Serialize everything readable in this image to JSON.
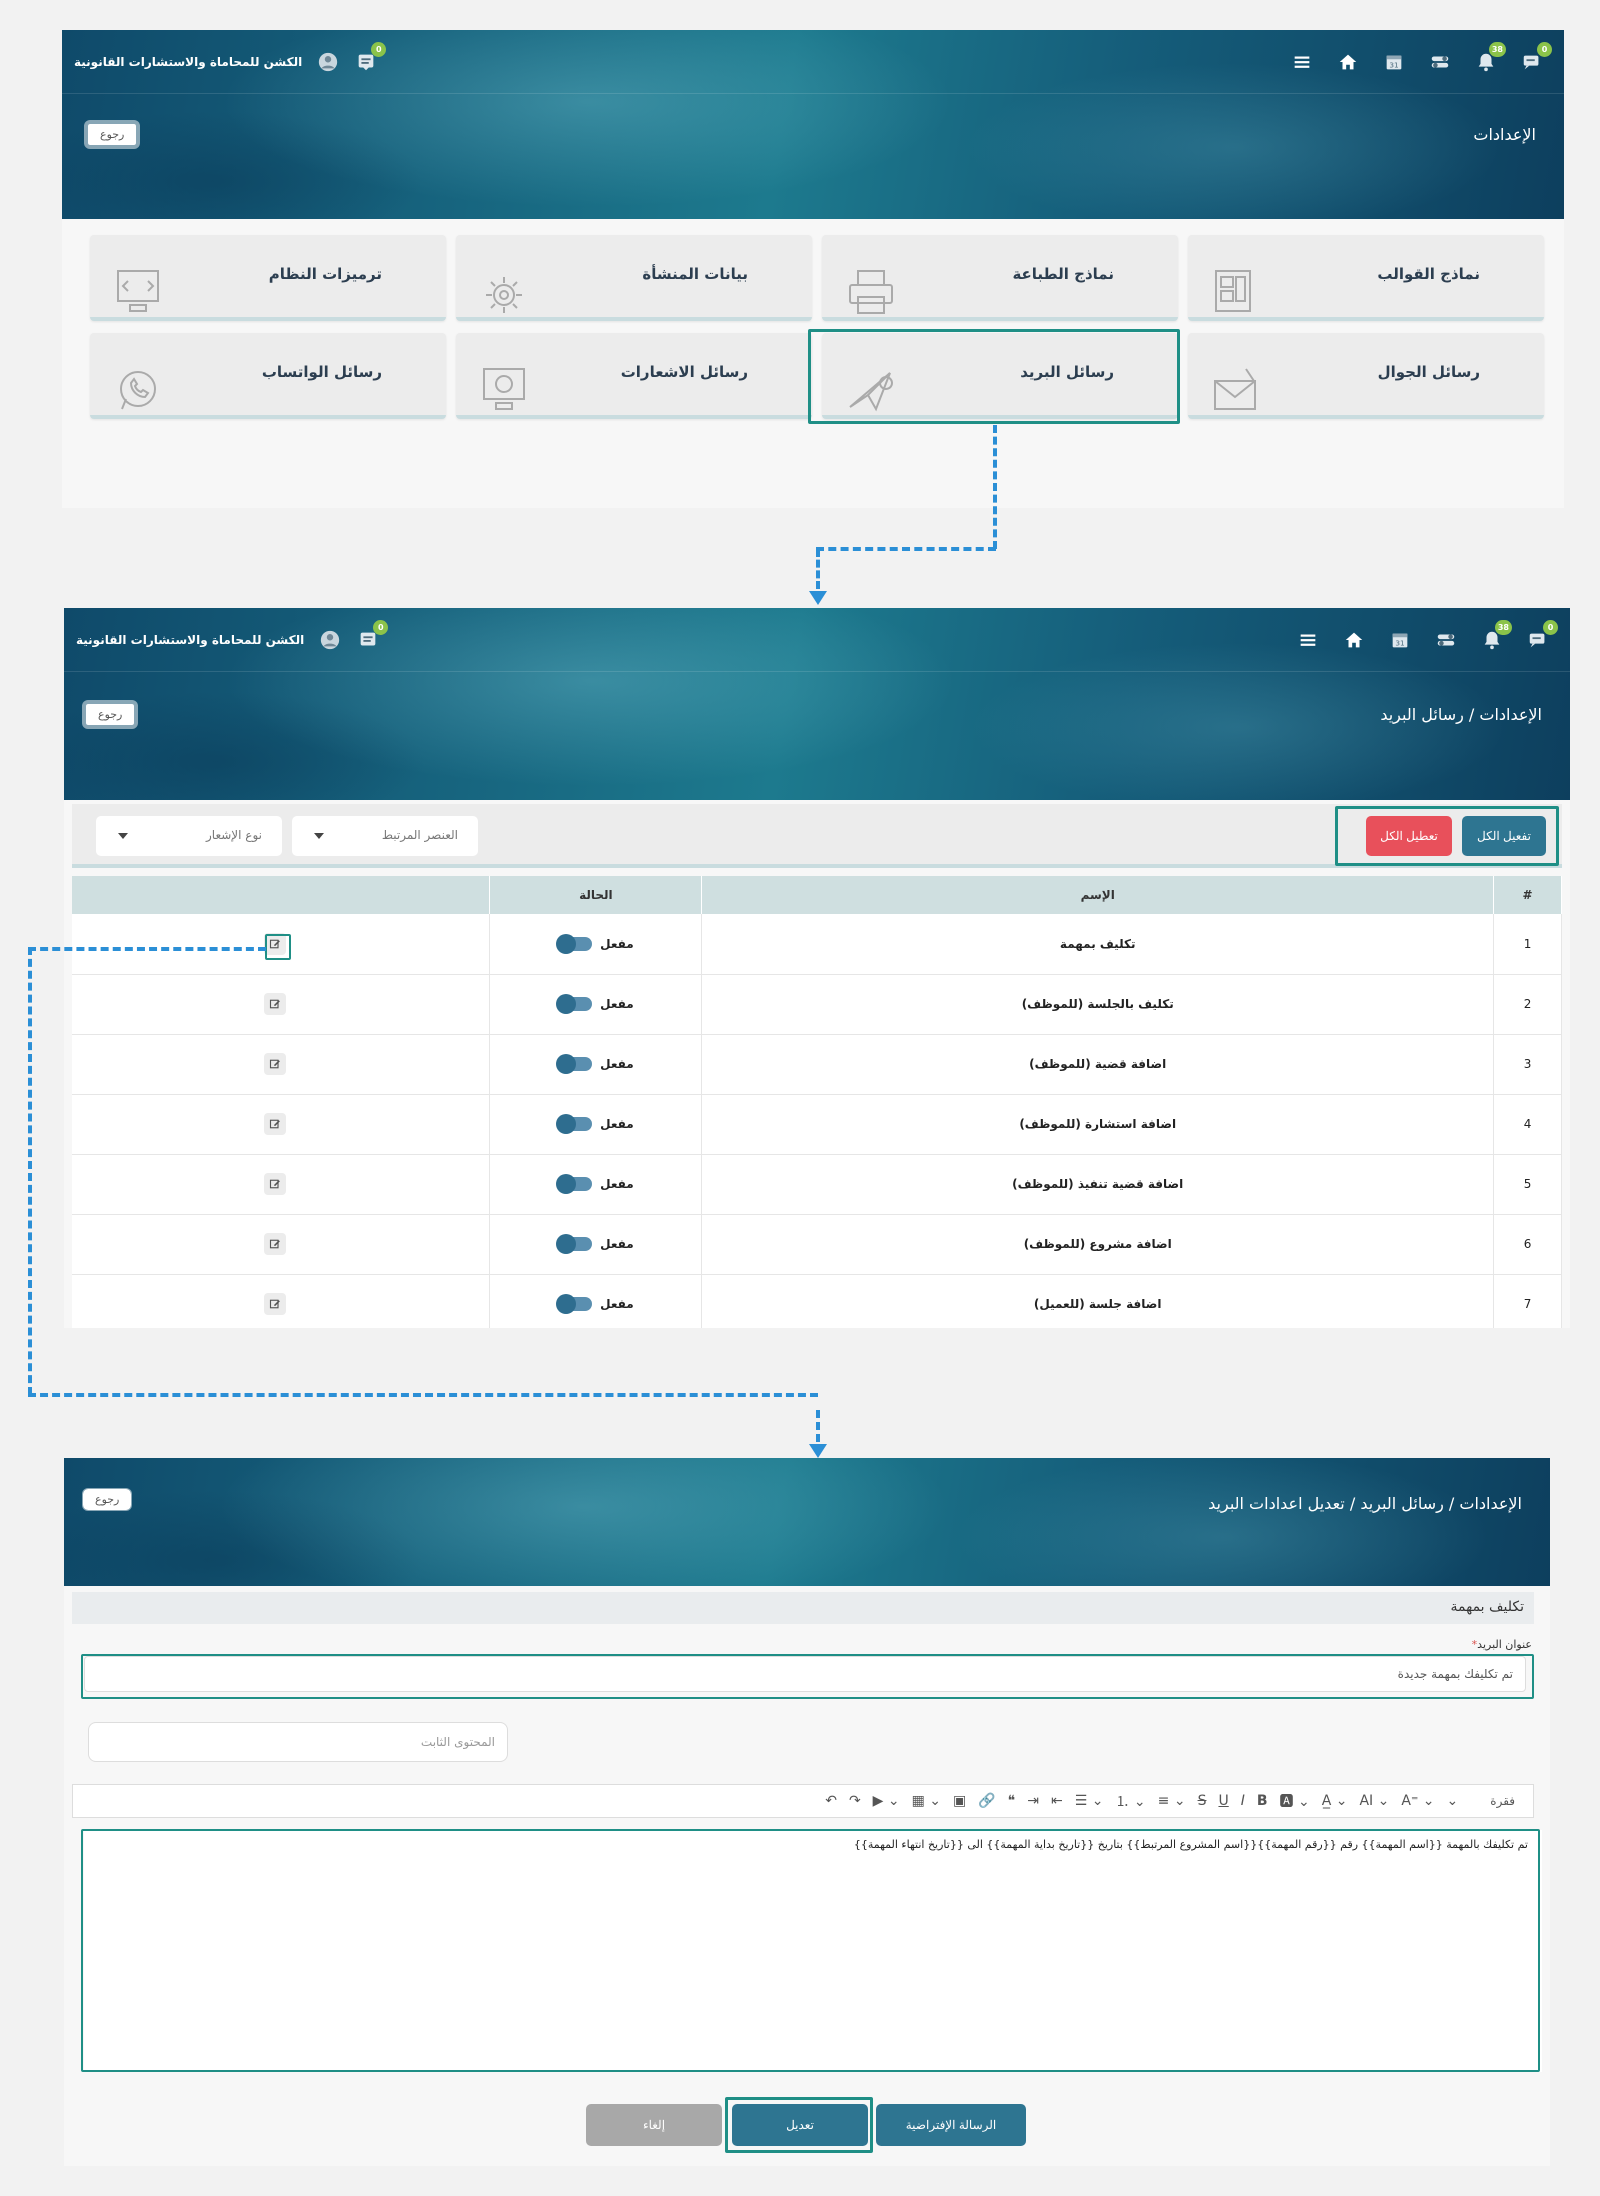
{
  "header": {
    "firm_name": "الكشن للمحاماة والاستشارات القانونية",
    "messages_badge": "0",
    "chat_badge": "0",
    "notifications_badge": "38",
    "calendar_day": "31"
  },
  "colors": {
    "accent": "#2e7591",
    "danger": "#e8505b",
    "highlight": "#1f8f86",
    "connector": "#2b8fd6"
  },
  "screen1": {
    "breadcrumb": "الإعدادات",
    "back_label": "رجوع",
    "tiles": [
      {
        "label": "نماذج القوالب",
        "icon": "template-icon"
      },
      {
        "label": "نماذج الطباعة",
        "icon": "printer-icon"
      },
      {
        "label": "بيانات المنشأة",
        "icon": "gear-icon"
      },
      {
        "label": "ترميزات النظام",
        "icon": "code-icon"
      },
      {
        "label": "رسائل الجوال",
        "icon": "envelope-icon"
      },
      {
        "label": "رسائل البريد",
        "icon": "paper-plane-icon"
      },
      {
        "label": "رسائل الاشعارات",
        "icon": "monitor-icon"
      },
      {
        "label": "رسائل الواتساب",
        "icon": "whatsapp-icon"
      }
    ]
  },
  "screen2": {
    "breadcrumb_root": "الإعدادات",
    "breadcrumb_sep": "/",
    "breadcrumb_current": "رسائل البريد",
    "back_label": "رجوع",
    "enable_all": "تفعيل الكل",
    "disable_all": "تعطيل الكل",
    "filter_related": "العنصر المرتبط",
    "filter_type": "نوع الإشعار",
    "columns": {
      "index": "#",
      "name": "الإسم",
      "status": "الحالة"
    },
    "rows": [
      {
        "index": "1",
        "name": "تكليف بمهمة",
        "status": "مفعل"
      },
      {
        "index": "2",
        "name": "تكليف بالجلسة (للموظف)",
        "status": "مفعل"
      },
      {
        "index": "3",
        "name": "اضافة قضية (للموظف)",
        "status": "مفعل"
      },
      {
        "index": "4",
        "name": "اضافة استشارة (للموظف)",
        "status": "مفعل"
      },
      {
        "index": "5",
        "name": "اضافة قضية تنفيذ (للموظف)",
        "status": "مفعل"
      },
      {
        "index": "6",
        "name": "اضافة مشروع (للموظف)",
        "status": "مفعل"
      },
      {
        "index": "7",
        "name": "اضافة جلسة (للعميل)",
        "status": "مفعل"
      }
    ]
  },
  "screen3": {
    "breadcrumb_root": "الإعدادات",
    "breadcrumb_sep": "/",
    "breadcrumb_mid": "رسائل البريد",
    "breadcrumb_current": "تعديل اعدادات البريد",
    "back_label": "رجوع",
    "section_title": "تكليف بمهمة",
    "subject_label": "عنوان البريد",
    "subject_required": "*",
    "subject_value": "تم تكليفك بمهمة جديدة",
    "static_placeholder": "المحتوى الثابت",
    "editor_paragraph": "فقرة",
    "editor_ai": "AI",
    "editor_body": "تم تكليفك بالمهمة {{اسم المهمة}} رقم {{رقم المهمة}}{{اسم المشروع المرتبط}} بتاريخ {{تاريخ بداية المهمة}} الى {{تاريخ انتهاء المهمة}}",
    "default_message": "الرسالة الإفتراضية",
    "edit": "تعديل",
    "cancel": "إلغاء"
  }
}
